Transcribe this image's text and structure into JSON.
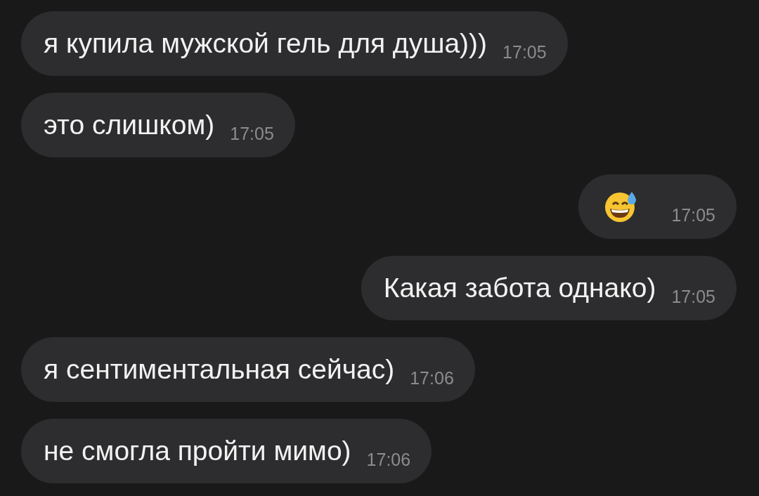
{
  "messages": [
    {
      "kind": "text",
      "outgoing": false,
      "text": "я купила мужской гель для душа)))",
      "time": "17:05"
    },
    {
      "kind": "text",
      "outgoing": false,
      "text": "это слишком)",
      "time": "17:05"
    },
    {
      "kind": "emoji",
      "outgoing": true,
      "time": "17:05"
    },
    {
      "kind": "text",
      "outgoing": true,
      "text": "Какая забота однако)",
      "time": "17:05"
    },
    {
      "kind": "text",
      "outgoing": false,
      "text": "я сентиментальная сейчас)",
      "time": "17:06"
    },
    {
      "kind": "text",
      "outgoing": false,
      "text": "не смогла пройти мимо)",
      "time": "17:06"
    }
  ]
}
